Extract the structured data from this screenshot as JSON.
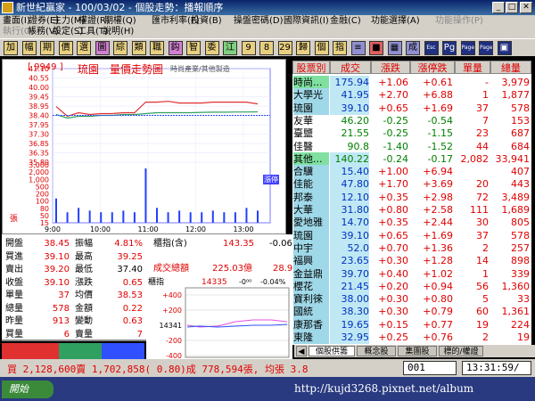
{
  "window": {
    "title": "新世紀贏家 - 100/03/02 - 個股走勢：播報順序",
    "min": "_",
    "max": "□",
    "close": "✕"
  },
  "menus": [
    {
      "label": "畫面(I)",
      "disabled": false
    },
    {
      "label": "證券(E)",
      "disabled": false
    },
    {
      "label": "主力(M)",
      "disabled": false
    },
    {
      "label": "權證(R)",
      "disabled": false
    },
    {
      "label": "期權(Q)",
      "disabled": false
    },
    {
      "label": "匯市利率(F)",
      "disabled": false
    },
    {
      "label": "投資(B)",
      "disabled": false
    },
    {
      "label": "操盤密碼(D)",
      "disabled": false
    },
    {
      "label": "國際資訊(I)",
      "disabled": false
    },
    {
      "label": "金融(C)",
      "disabled": false
    },
    {
      "label": "功能選擇(A)",
      "disabled": false
    },
    {
      "label": "功能操作(P)",
      "disabled": true
    },
    {
      "label": "執行(O)",
      "disabled": true
    },
    {
      "label": "帳務(V)",
      "disabled": false
    },
    {
      "label": "設定(S)",
      "disabled": false
    },
    {
      "label": "工具(T)",
      "disabled": false
    },
    {
      "label": "說明(H)",
      "disabled": false
    }
  ],
  "toolbar": [
    {
      "label": "加",
      "bg": "#e8d080"
    },
    {
      "label": "幅",
      "bg": "#e8d080"
    },
    {
      "label": "期",
      "bg": "#e8d080"
    },
    {
      "label": "價",
      "bg": "#e8d080"
    },
    {
      "label": "選",
      "bg": "#e8d080"
    },
    {
      "label": "圖",
      "bg": "#d080d0"
    },
    {
      "label": "綜",
      "bg": "#e8d080"
    },
    {
      "label": "類",
      "bg": "#e8d080"
    },
    {
      "label": "職",
      "bg": "#e8d080"
    },
    {
      "label": "鈎",
      "bg": "#d080d0"
    },
    {
      "label": "智",
      "bg": "#e8d080"
    },
    {
      "label": "委",
      "bg": "#e8d080"
    },
    {
      "label": "江",
      "bg": "#80d080"
    },
    {
      "label": "9",
      "bg": "#e8d080"
    },
    {
      "label": "8",
      "bg": "#e8d080"
    },
    {
      "label": "29",
      "bg": "#e8d080"
    },
    {
      "label": "歸",
      "bg": "#e8d080"
    },
    {
      "label": "個",
      "bg": "#e8d080"
    },
    {
      "label": "指",
      "bg": "#e8d080"
    },
    {
      "label": "≡",
      "bg": "#9090d0"
    },
    {
      "label": "■",
      "bg": "#e06060"
    },
    {
      "label": "▦",
      "bg": "#9090d0"
    },
    {
      "label": "成",
      "bg": "#9090d0"
    },
    {
      "label": "Esc",
      "bg": "#203080"
    },
    {
      "label": "Pg",
      "bg": "#203080"
    },
    {
      "label": "Page",
      "bg": "#203080"
    },
    {
      "label": "Page",
      "bg": "#203080"
    },
    {
      "label": "▣",
      "bg": "#203080"
    }
  ],
  "chart": {
    "code": "[ 9949 ]",
    "name": "琉園",
    "title": "量價走勢圖",
    "industry": "時尚產業/其他製造",
    "price_labels": [
      "41.10",
      "40.55",
      "40.00",
      "39.45",
      "38.95",
      "38.40",
      "37.95",
      "37.30",
      "36.85",
      "36.35",
      "35.80"
    ],
    "volume_labels": [
      "3,000",
      "2,000",
      "1,000",
      "500",
      "200",
      "100",
      "80",
      "50",
      "15"
    ],
    "volume_unit": "張",
    "time_labels": [
      "9:00",
      "10:00",
      "11:00",
      "12:00",
      "13:00"
    ],
    "badge": "漲停",
    "badge_color": "#6060ff",
    "accent_color": "#ff3030"
  },
  "chart_data": {
    "type": "line",
    "title": "量價走勢圖",
    "x": [
      "9:00",
      "9:15",
      "9:30",
      "9:45",
      "10:00",
      "10:15",
      "10:30",
      "10:45",
      "11:00",
      "11:15",
      "11:30",
      "11:45",
      "12:00",
      "12:15",
      "12:30",
      "12:45",
      "13:00",
      "13:15",
      "13:30"
    ],
    "series": [
      {
        "name": "price",
        "values": [
          38.95,
          38.4,
          38.6,
          38.5,
          38.55,
          38.55,
          38.6,
          38.6,
          39.2,
          39.2,
          39.25,
          39.15,
          39.15,
          39.15,
          39.2,
          39.2,
          39.2,
          39.2,
          39.1
        ]
      },
      {
        "name": "avg",
        "values": [
          38.5,
          38.3,
          38.4,
          38.4,
          38.45,
          38.45,
          38.5,
          38.5,
          38.55,
          38.6,
          38.6,
          38.6,
          38.6,
          38.62,
          38.63,
          38.63,
          38.64,
          38.64,
          38.65
        ]
      }
    ],
    "volume": [
      80,
      15,
      30,
      20,
      15,
      15,
      20,
      15,
      400,
      30,
      15,
      20,
      15,
      15,
      20,
      15,
      15,
      30,
      20
    ],
    "ylim": [
      35.8,
      41.1
    ]
  },
  "quote": {
    "labels": {
      "open": "開盤",
      "bid": "買進",
      "ask": "賣出",
      "close": "收盤",
      "unit": "單量",
      "total": "總量",
      "yvol": "昨量",
      "buyvol": "買量",
      "amp": "振幅",
      "high": "最高",
      "low": "最低",
      "chg": "漲跌",
      "avg": "均價",
      "amount": "金額",
      "turn": "變動",
      "sellvol": "賣量",
      "ticket": "櫃指(含)",
      "turnover": "成交總額"
    },
    "values": {
      "open": "38.45",
      "bid": "39.10",
      "ask": "39.20",
      "close": "39.10",
      "unit": "37",
      "total": "578",
      "yvol": "913",
      "buyvol": "6",
      "amp": "4.81%",
      "high": "39.25",
      "low": "37.40",
      "chg": "0.65",
      "avg": "38.53",
      "amount": "0.22",
      "turn": "0.63",
      "sellvol": "7",
      "ticket": "143.35",
      "ticket_chg": "-0.06",
      "turnover": "225.03億",
      "turnover2": "28.9"
    }
  },
  "mini": {
    "label": "櫃指",
    "value": "143",
    "superscript": "35",
    "chg": "-0⁰⁰",
    "pct": "-0.04%",
    "ylabels": [
      "+400",
      "+200",
      "14341",
      "-200",
      "-400"
    ]
  },
  "list": {
    "headers": [
      "股票別",
      "成交",
      "漲跌",
      "漲停跌",
      "單量",
      "總量"
    ],
    "rows": [
      {
        "name": "時尚...",
        "p": "175.94",
        "c": "+1.06",
        "l": "+0.61",
        "u": "-",
        "t": "3,979",
        "hl": "#7fe0a0"
      },
      {
        "name": "大學光",
        "p": "41.95",
        "c": "+2.70",
        "l": "+6.88",
        "u": "1",
        "t": "1,877",
        "hl": "#9fd8e8"
      },
      {
        "name": "琉園",
        "p": "39.10",
        "c": "+0.65",
        "l": "+1.69",
        "u": "37",
        "t": "578",
        "hl": "#9fd8e8"
      },
      {
        "name": "友華",
        "p": "46.20",
        "c": "-0.25",
        "l": "-0.54",
        "u": "7",
        "t": "153",
        "hl": ""
      },
      {
        "name": "臺鹽",
        "p": "21.55",
        "c": "-0.25",
        "l": "-1.15",
        "u": "23",
        "t": "687",
        "hl": ""
      },
      {
        "name": "佳醫",
        "p": "90.8",
        "c": "-1.40",
        "l": "-1.52",
        "u": "44",
        "t": "684",
        "hl": ""
      },
      {
        "name": "其他...",
        "p": "140.22",
        "c": "-0.24",
        "l": "-0.17",
        "u": "2,082",
        "t": "33,941",
        "hl": "#7fe0a0"
      },
      {
        "name": "合驥",
        "p": "15.40",
        "c": "+1.00",
        "l": "+6.94",
        "u": "",
        "t": "407",
        "hl": "#9fd8e8"
      },
      {
        "name": "佳能",
        "p": "47.80",
        "c": "+1.70",
        "l": "+3.69",
        "u": "20",
        "t": "443",
        "hl": "#9fd8e8"
      },
      {
        "name": "邦泰",
        "p": "12.10",
        "c": "+0.35",
        "l": "+2.98",
        "u": "72",
        "t": "3,489",
        "hl": "#9fd8e8"
      },
      {
        "name": "大華",
        "p": "31.80",
        "c": "+0.80",
        "l": "+2.58",
        "u": "111",
        "t": "1,689",
        "hl": "#9fd8e8"
      },
      {
        "name": "愛地雅",
        "p": "14.70",
        "c": "+0.35",
        "l": "+2.44",
        "u": "30",
        "t": "805",
        "hl": "#9fd8e8"
      },
      {
        "name": "琉園",
        "p": "39.10",
        "c": "+0.65",
        "l": "+1.69",
        "u": "37",
        "t": "578",
        "hl": "#9fd8e8"
      },
      {
        "name": "中宇",
        "p": "52.0",
        "c": "+0.70",
        "l": "+1.36",
        "u": "2",
        "t": "257",
        "hl": "#9fd8e8"
      },
      {
        "name": "福興",
        "p": "23.65",
        "c": "+0.30",
        "l": "+1.28",
        "u": "14",
        "t": "898",
        "hl": "#9fd8e8"
      },
      {
        "name": "金益鼎",
        "p": "39.70",
        "c": "+0.40",
        "l": "+1.02",
        "u": "1",
        "t": "339",
        "hl": "#9fd8e8"
      },
      {
        "name": "櫻花",
        "p": "21.45",
        "c": "+0.20",
        "l": "+0.94",
        "u": "56",
        "t": "1,360",
        "hl": "#9fd8e8"
      },
      {
        "name": "寶利徠",
        "p": "38.00",
        "c": "+0.30",
        "l": "+0.80",
        "u": "5",
        "t": "33",
        "hl": "#9fd8e8"
      },
      {
        "name": "國統",
        "p": "38.30",
        "c": "+0.30",
        "l": "+0.79",
        "u": "60",
        "t": "1,361",
        "hl": "#9fd8e8"
      },
      {
        "name": "康那香",
        "p": "19.65",
        "c": "+0.15",
        "l": "+0.77",
        "u": "19",
        "t": "224",
        "hl": "#9fd8e8"
      },
      {
        "name": "東隆",
        "p": "32.95",
        "c": "+0.25",
        "l": "+0.76",
        "u": "2",
        "t": "19",
        "hl": "#9fd8e8"
      }
    ]
  },
  "tabs": [
    "個股供籌",
    "概念股",
    "集團股",
    "標的/權證"
  ],
  "status": {
    "text": "買 2,128,600賣 1,702,858( 0.80)成 778,594張, 均張 3.8",
    "code": "001",
    "time": "13:31:59/"
  },
  "taskbar": {
    "start": "開始",
    "watermark": "http://kujd3268.pixnet.net/album"
  }
}
